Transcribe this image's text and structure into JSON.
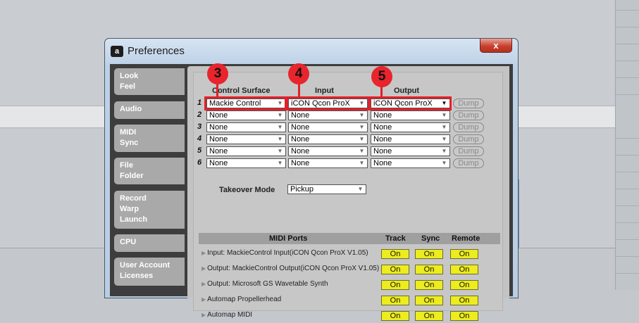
{
  "window": {
    "title": "Preferences",
    "close_label": "x",
    "icon_label": "a"
  },
  "tabs": [
    {
      "lines": [
        "Look",
        "Feel"
      ]
    },
    {
      "lines": [
        "Audio"
      ]
    },
    {
      "lines": [
        "MIDI",
        "Sync"
      ]
    },
    {
      "lines": [
        "File",
        "Folder"
      ]
    },
    {
      "lines": [
        "Record",
        "Warp",
        "Launch"
      ]
    },
    {
      "lines": [
        "CPU"
      ]
    },
    {
      "lines": [
        "User Account",
        "Licenses"
      ]
    }
  ],
  "surfaces": {
    "headers": {
      "control_surface": "Control Surface",
      "input": "Input",
      "output": "Output"
    },
    "dump_label": "Dump",
    "rows": [
      {
        "num": "1",
        "surface": "Mackie Control",
        "input": "iCON Qcon ProX",
        "output": "iCON Qcon ProX"
      },
      {
        "num": "2",
        "surface": "None",
        "input": "None",
        "output": "None"
      },
      {
        "num": "3",
        "surface": "None",
        "input": "None",
        "output": "None"
      },
      {
        "num": "4",
        "surface": "None",
        "input": "None",
        "output": "None"
      },
      {
        "num": "5",
        "surface": "None",
        "input": "None",
        "output": "None"
      },
      {
        "num": "6",
        "surface": "None",
        "input": "None",
        "output": "None"
      }
    ]
  },
  "callouts": [
    "3",
    "4",
    "5"
  ],
  "takeover": {
    "label": "Takeover Mode",
    "value": "Pickup"
  },
  "midi_ports": {
    "headers": {
      "ports": "MIDI Ports",
      "track": "Track",
      "sync": "Sync",
      "remote": "Remote"
    },
    "on_label": "On",
    "rows": [
      {
        "name": "Input:   MackieControl Input(iCON Qcon ProX V1.05)"
      },
      {
        "name": "Output: MackieControl Output(iCON Qcon ProX V1.05)"
      },
      {
        "name": "Output: Microsoft GS Wavetable Synth"
      },
      {
        "name": "Automap Propellerhead"
      },
      {
        "name": "Automap MIDI"
      }
    ]
  },
  "colors": {
    "highlight": "#e2202a",
    "on_button": "#ecec1e"
  }
}
